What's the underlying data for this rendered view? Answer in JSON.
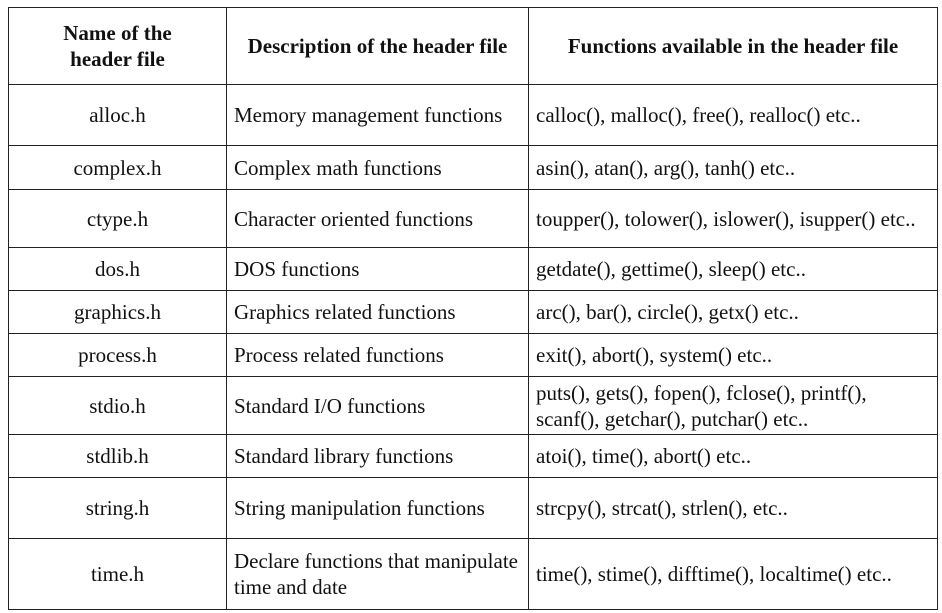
{
  "headers": [
    "Name of the header file",
    "Description of the header file",
    "Functions available in the header file"
  ],
  "rows": [
    {
      "name": "alloc.h",
      "description": "Memory management functions",
      "functions": "calloc(), malloc(), free(), realloc() etc.."
    },
    {
      "name": "complex.h",
      "description": "Complex math functions",
      "functions": "asin(), atan(), arg(), tanh() etc.."
    },
    {
      "name": "ctype.h",
      "description": "Character oriented functions",
      "functions": "toupper(), tolower(), islower(), isupper() etc.."
    },
    {
      "name": "dos.h",
      "description": "DOS functions",
      "functions": "getdate(), gettime(), sleep() etc.."
    },
    {
      "name": "graphics.h",
      "description": "Graphics related functions",
      "functions": "arc(), bar(), circle(), getx() etc.."
    },
    {
      "name": "process.h",
      "description": "Process related functions",
      "functions": "exit(), abort(), system() etc.."
    },
    {
      "name": "stdio.h",
      "description": "Standard I/O functions",
      "functions": "puts(), gets(), fopen(), fclose(), printf(), scanf(), getchar(), putchar() etc.."
    },
    {
      "name": "stdlib.h",
      "description": "Standard library functions",
      "functions": "atoi(), time(), abort() etc.."
    },
    {
      "name": "string.h",
      "description": "String manipulation functions",
      "functions": "strcpy(), strcat(), strlen(), etc.."
    },
    {
      "name": "time.h",
      "description": "Declare functions that manipulate time and date",
      "functions": "time(), stime(), difftime(), localtime() etc.."
    }
  ]
}
